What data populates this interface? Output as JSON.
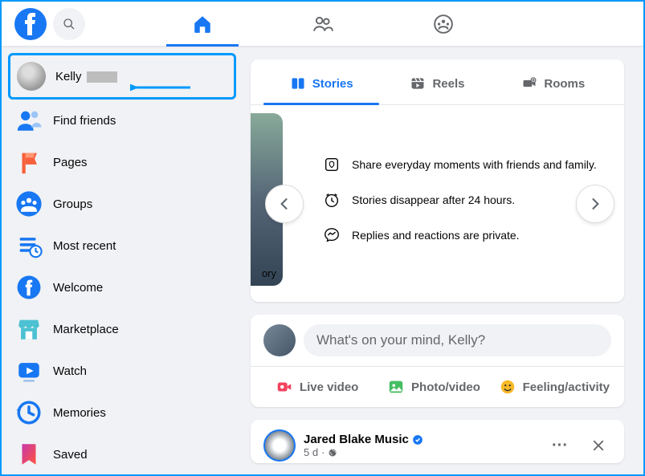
{
  "header": {
    "nav": [
      "home",
      "friends",
      "groups"
    ]
  },
  "sidebar": {
    "profile_name": "Kelly",
    "items": [
      {
        "label": "Find friends",
        "icon": "friends"
      },
      {
        "label": "Pages",
        "icon": "flag"
      },
      {
        "label": "Groups",
        "icon": "groups"
      },
      {
        "label": "Most recent",
        "icon": "recent"
      },
      {
        "label": "Welcome",
        "icon": "fb"
      },
      {
        "label": "Marketplace",
        "icon": "market"
      },
      {
        "label": "Watch",
        "icon": "watch"
      },
      {
        "label": "Memories",
        "icon": "memories"
      },
      {
        "label": "Saved",
        "icon": "saved"
      }
    ]
  },
  "subtabs": {
    "stories": "Stories",
    "reels": "Reels",
    "rooms": "Rooms"
  },
  "stories": {
    "preview_label": "ory",
    "info1": "Share everyday moments with friends and family.",
    "info2": "Stories disappear after 24 hours.",
    "info3": "Replies and reactions are private."
  },
  "composer": {
    "placeholder": "What's on your mind, Kelly?",
    "live": "Live video",
    "photo": "Photo/video",
    "feeling": "Feeling/activity"
  },
  "post": {
    "author": "Jared Blake Music",
    "verified": true,
    "time": "5 d",
    "privacy": "public"
  }
}
